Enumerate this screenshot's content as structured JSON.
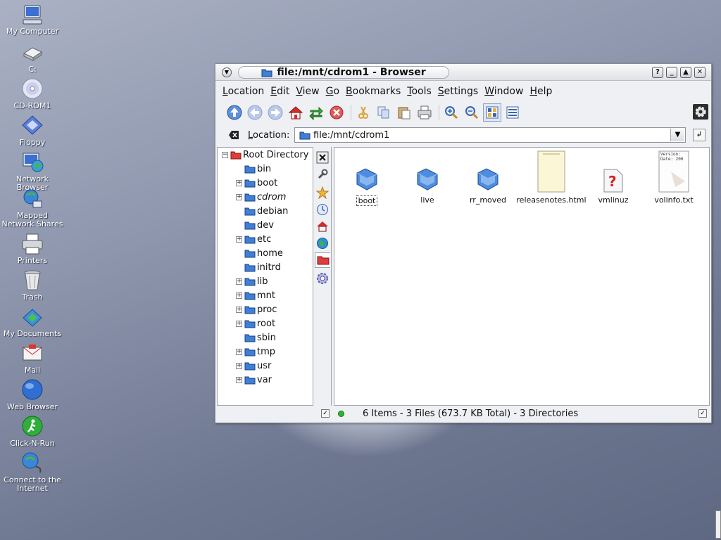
{
  "desktop": {
    "icons": [
      {
        "label": "My Computer",
        "icon": "computer-icon"
      },
      {
        "label": "C:",
        "icon": "hard-drive-icon"
      },
      {
        "label": "CD-ROM1",
        "icon": "cdrom-icon"
      },
      {
        "label": "Floppy",
        "icon": "floppy-icon"
      },
      {
        "label": "Network Browser",
        "icon": "network-browser-icon"
      },
      {
        "label": "Mapped Network Shares",
        "icon": "mapped-shares-icon"
      },
      {
        "label": "Printers",
        "icon": "printer-icon"
      },
      {
        "label": "Trash",
        "icon": "trash-icon"
      },
      {
        "label": "My Documents",
        "icon": "documents-icon"
      },
      {
        "label": "Mail",
        "icon": "mail-icon"
      },
      {
        "label": "Web Browser",
        "icon": "web-browser-icon"
      },
      {
        "label": "Click-N-Run",
        "icon": "click-n-run-icon"
      },
      {
        "label": "Connect to the Internet",
        "icon": "connect-internet-icon"
      }
    ]
  },
  "window": {
    "title": "file:/mnt/cdrom1 - Browser",
    "title_buttons": [
      "?",
      "_",
      "▲",
      "✕"
    ],
    "menu": [
      "Location",
      "Edit",
      "View",
      "Go",
      "Bookmarks",
      "Tools",
      "Settings",
      "Window",
      "Help"
    ],
    "toolbar": [
      "up-arrow-icon",
      "back-arrow-icon",
      "forward-arrow-icon",
      "home-icon",
      "reload-icon",
      "stop-icon",
      "cut-icon",
      "copy-icon",
      "paste-icon",
      "print-icon",
      "zoom-in-icon",
      "zoom-out-icon",
      "icon-view-icon",
      "detail-view-icon"
    ],
    "location": {
      "label": "Location:",
      "value": "file:/mnt/cdrom1"
    },
    "tree": {
      "root": "Root Directory",
      "items": [
        {
          "label": "bin",
          "expandable": false,
          "italic": false
        },
        {
          "label": "boot",
          "expandable": true,
          "italic": false
        },
        {
          "label": "cdrom",
          "expandable": true,
          "italic": true
        },
        {
          "label": "debian",
          "expandable": false,
          "italic": false
        },
        {
          "label": "dev",
          "expandable": false,
          "italic": false
        },
        {
          "label": "etc",
          "expandable": true,
          "italic": false
        },
        {
          "label": "home",
          "expandable": false,
          "italic": false
        },
        {
          "label": "initrd",
          "expandable": false,
          "italic": false
        },
        {
          "label": "lib",
          "expandable": true,
          "italic": false
        },
        {
          "label": "mnt",
          "expandable": true,
          "italic": false
        },
        {
          "label": "proc",
          "expandable": true,
          "italic": false
        },
        {
          "label": "root",
          "expandable": true,
          "italic": false
        },
        {
          "label": "sbin",
          "expandable": false,
          "italic": false
        },
        {
          "label": "tmp",
          "expandable": true,
          "italic": false
        },
        {
          "label": "usr",
          "expandable": true,
          "italic": false
        },
        {
          "label": "var",
          "expandable": true,
          "italic": false
        }
      ]
    },
    "sidebar_tabs": [
      "close-icon",
      "tools-icon",
      "bookmarks-star-icon",
      "history-clock-icon",
      "home-icon",
      "network-globe-icon",
      "root-folder-icon",
      "services-icon"
    ],
    "files": [
      {
        "name": "boot",
        "type": "folder"
      },
      {
        "name": "live",
        "type": "folder"
      },
      {
        "name": "rr_moved",
        "type": "folder"
      },
      {
        "name": "releasenotes.html",
        "type": "html"
      },
      {
        "name": "vmlinuz",
        "type": "unknown"
      },
      {
        "name": "volinfo.txt",
        "type": "text",
        "preview": "Version: Date: 200"
      }
    ],
    "status": "6 Items - 3 Files (673.7 KB Total) - 3 Directories"
  },
  "colors": {
    "folder_blue": "#3f7fd6",
    "status_green": "#2fb52f",
    "title_bar": "#e8e9ec"
  }
}
